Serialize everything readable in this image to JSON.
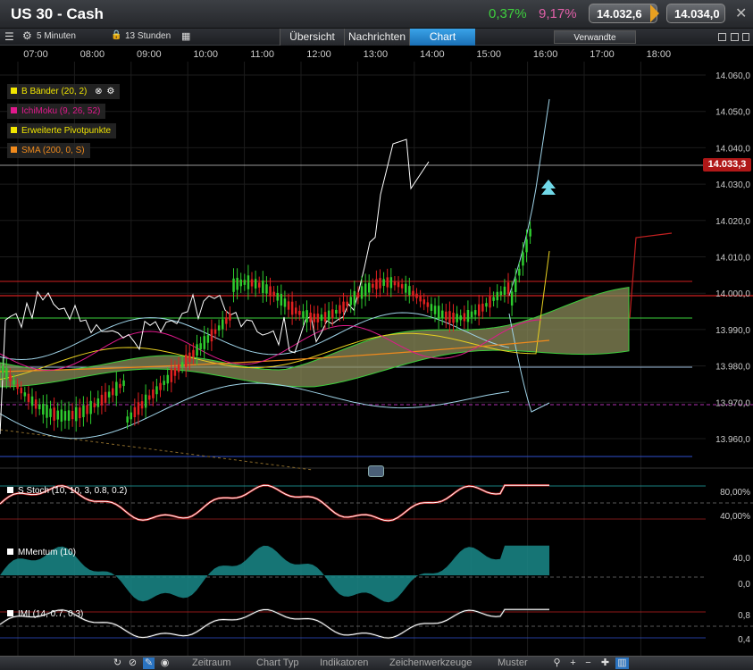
{
  "header": {
    "title": "US 30 - Cash",
    "change_day": "0,37%",
    "change_year": "9,17%",
    "bid": "14.032,6",
    "ask": "14.034,0"
  },
  "toolbar": {
    "interval": "5 Minuten",
    "range": "13 Stunden",
    "tabs": [
      "Übersicht",
      "Nachrichten",
      "Chart"
    ],
    "active_tab": "Chart",
    "related": "Verwandte"
  },
  "time_axis": [
    "07:00",
    "08:00",
    "09:00",
    "10:00",
    "11:00",
    "12:00",
    "13:00",
    "14:00",
    "15:00",
    "16:00",
    "17:00",
    "18:00"
  ],
  "price_axis": [
    "14.060,0",
    "14.050,0",
    "14.040,0",
    "14.030,0",
    "14.020,0",
    "14.010,0",
    "14.000,0",
    "13.990,0",
    "13.980,0",
    "13.970,0",
    "13.960,0"
  ],
  "legend": [
    {
      "label": "B Bänder (20, 2)",
      "color": "#f2e600"
    },
    {
      "label": "IchiMoku (9, 26, 52)",
      "color": "#e0198c"
    },
    {
      "label": "Erweiterte Pivotpunkte",
      "color": "#f2e600"
    },
    {
      "label": "SMA (200, 0, S)",
      "color": "#f08a1c"
    }
  ],
  "current_price": "14.033,3",
  "indicators": {
    "stoch": {
      "label": "S Stoch (10, 10, 3, 0.8, 0.2)",
      "levels": [
        "80,00%",
        "40,00%"
      ]
    },
    "momentum": {
      "label": "MMentum (10)",
      "levels": [
        "40,0",
        "0,0"
      ]
    },
    "imi": {
      "label": "IMI (14, 0.7, 0.3)",
      "levels": [
        "0,8",
        "0,4"
      ]
    }
  },
  "bottom_menu": [
    "Zeitraum",
    "Chart Typ",
    "Indikatoren",
    "Zeichenwerkzeuge",
    "Muster"
  ],
  "colors": {
    "up": "#2ecc2e",
    "down": "#e02020",
    "cloud": "#8b8b5a",
    "bollinger": "#9fd3e8",
    "accent": "#1a8fe0"
  }
}
